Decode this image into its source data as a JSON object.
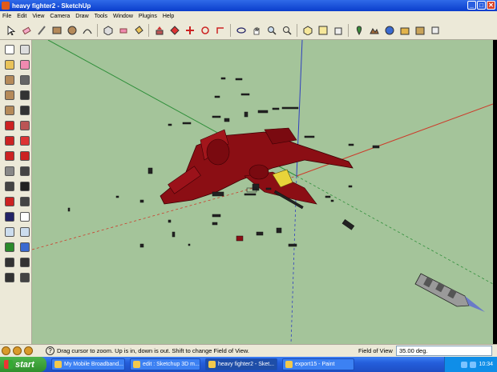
{
  "window": {
    "title": "heavy fighter2 - SketchUp",
    "min_symbol": "_",
    "max_symbol": "□",
    "close_symbol": "✕"
  },
  "menu": [
    "File",
    "Edit",
    "View",
    "Camera",
    "Draw",
    "Tools",
    "Window",
    "Plugins",
    "Help"
  ],
  "toolbar": {
    "icons": [
      "select-icon",
      "eraser-icon",
      "pencil-icon",
      "rectangle-icon",
      "circle-icon",
      "arc-icon",
      "make-component-icon",
      "paint-bucket-icon",
      "push-pull-icon",
      "follow-me-icon",
      "move-icon",
      "rotate-icon",
      "offset-icon",
      "orbit-icon",
      "pan-icon",
      "zoom-icon",
      "zoom-extents-icon",
      "iso-view-icon",
      "top-view-icon",
      "front-view-icon",
      "add-location-icon",
      "toggle-terrain-icon",
      "get-models-icon",
      "share-model-icon",
      "get-photo-texture-icon",
      "place-model-icon"
    ]
  },
  "left_tools": [
    "select-icon",
    "make-component-icon",
    "paint-bucket-icon",
    "eraser-icon",
    "rectangle-icon",
    "line-icon",
    "circle-icon",
    "arc-icon",
    "polygon-icon",
    "freehand-icon",
    "move-icon",
    "push-pull-icon",
    "rotate-icon",
    "follow-me-icon",
    "scale-icon",
    "offset-icon",
    "tape-measure-icon",
    "dimension-icon",
    "protractor-icon",
    "text-icon",
    "axes-icon",
    "3d-text-icon",
    "orbit-icon",
    "pan-icon",
    "zoom-icon",
    "zoom-window-icon",
    "previous-view-icon",
    "zoom-extents-icon",
    "position-camera-icon",
    "look-around-icon",
    "walk-icon",
    "section-plane-icon"
  ],
  "status": {
    "hint": "Drag cursor to zoom.  Up is in, down is out. Shift to change Field of View.",
    "vcb_label": "Field of View",
    "vcb_value": "35.00 deg."
  },
  "taskbar": {
    "start": "start",
    "tasks": [
      "My Mobile Broadband...",
      "edit : Sketchup 3D m...",
      "heavy fighter2 - Sket...",
      "export15 - Paint"
    ],
    "clock": "10:34"
  },
  "colors": {
    "viewport_bg": "#a4c49a",
    "model_red": "#8b0e14",
    "cockpit_yellow": "#e8d33a",
    "axis_red": "#cc3b2a",
    "axis_green": "#2f8f3a",
    "axis_blue": "#2f3fbf"
  }
}
